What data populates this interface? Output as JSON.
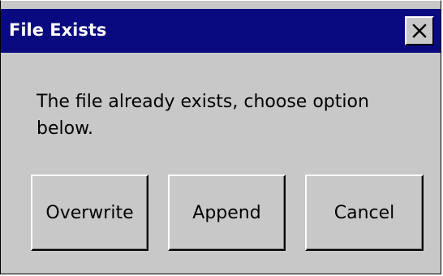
{
  "dialog": {
    "title": "File Exists",
    "close_symbol": "✕",
    "message": "The file already exists, choose option below.",
    "buttons": [
      {
        "label": "Overwrite"
      },
      {
        "label": "Append"
      },
      {
        "label": "Cancel"
      }
    ]
  },
  "icons": {
    "close": "close-icon"
  },
  "colors": {
    "titlebar": "#0a0a80",
    "title_text": "#ffffff",
    "dialog_bg": "#c8c8c8"
  }
}
